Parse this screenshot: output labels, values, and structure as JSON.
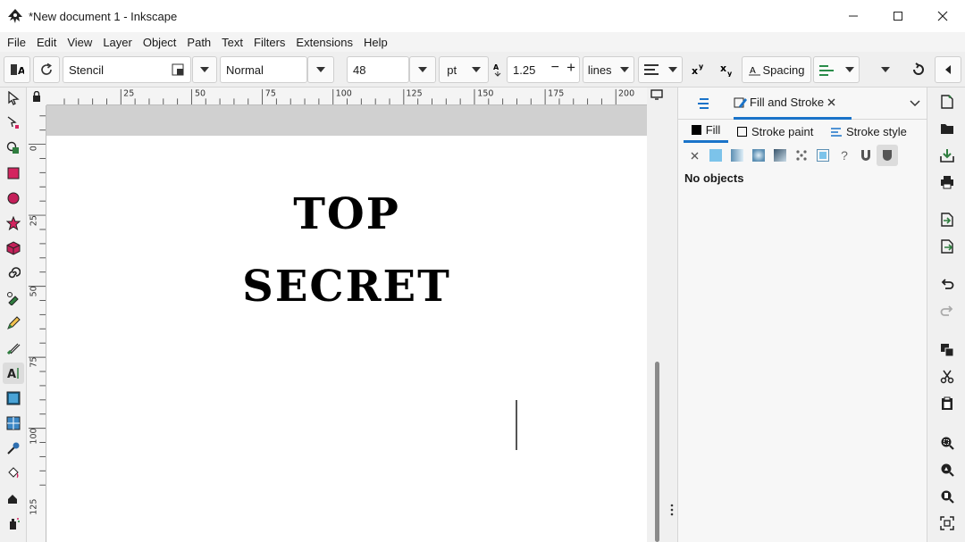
{
  "window": {
    "title": "*New document 1 - Inkscape"
  },
  "menu": [
    "File",
    "Edit",
    "View",
    "Layer",
    "Object",
    "Path",
    "Text",
    "Filters",
    "Extensions",
    "Help"
  ],
  "text_toolbar": {
    "font_family": "Stencil",
    "font_style": "Normal",
    "font_size": "48",
    "unit": "pt",
    "line_height": "1.25",
    "line_height_unit": "lines",
    "spacing_label": "Spacing"
  },
  "ruler_top": [
    "25",
    "50",
    "75",
    "100",
    "125",
    "150",
    "175",
    "200"
  ],
  "ruler_left": [
    "0",
    "25",
    "50",
    "75",
    "100",
    "125"
  ],
  "canvas": {
    "line1": "TOP",
    "line2": "SECRET"
  },
  "dock": {
    "tab_title": "Fill and Stroke",
    "subtabs": [
      "Fill",
      "Stroke paint",
      "Stroke style"
    ],
    "paint_question": "?",
    "status": "No objects"
  },
  "colors": {
    "accent": "#1a73c9",
    "rect_tool": "#d3245f",
    "ellipse_tool": "#c4205a"
  }
}
